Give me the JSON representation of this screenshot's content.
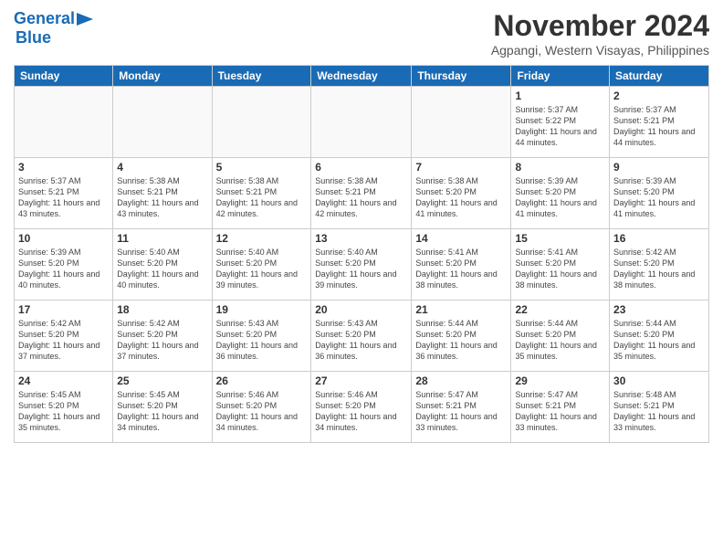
{
  "header": {
    "logo_general": "General",
    "logo_blue": "Blue",
    "month_year": "November 2024",
    "location": "Agpangi, Western Visayas, Philippines"
  },
  "days_of_week": [
    "Sunday",
    "Monday",
    "Tuesday",
    "Wednesday",
    "Thursday",
    "Friday",
    "Saturday"
  ],
  "weeks": [
    [
      {
        "day": "",
        "info": ""
      },
      {
        "day": "",
        "info": ""
      },
      {
        "day": "",
        "info": ""
      },
      {
        "day": "",
        "info": ""
      },
      {
        "day": "",
        "info": ""
      },
      {
        "day": "1",
        "info": "Sunrise: 5:37 AM\nSunset: 5:22 PM\nDaylight: 11 hours and 44 minutes."
      },
      {
        "day": "2",
        "info": "Sunrise: 5:37 AM\nSunset: 5:21 PM\nDaylight: 11 hours and 44 minutes."
      }
    ],
    [
      {
        "day": "3",
        "info": "Sunrise: 5:37 AM\nSunset: 5:21 PM\nDaylight: 11 hours and 43 minutes."
      },
      {
        "day": "4",
        "info": "Sunrise: 5:38 AM\nSunset: 5:21 PM\nDaylight: 11 hours and 43 minutes."
      },
      {
        "day": "5",
        "info": "Sunrise: 5:38 AM\nSunset: 5:21 PM\nDaylight: 11 hours and 42 minutes."
      },
      {
        "day": "6",
        "info": "Sunrise: 5:38 AM\nSunset: 5:21 PM\nDaylight: 11 hours and 42 minutes."
      },
      {
        "day": "7",
        "info": "Sunrise: 5:38 AM\nSunset: 5:20 PM\nDaylight: 11 hours and 41 minutes."
      },
      {
        "day": "8",
        "info": "Sunrise: 5:39 AM\nSunset: 5:20 PM\nDaylight: 11 hours and 41 minutes."
      },
      {
        "day": "9",
        "info": "Sunrise: 5:39 AM\nSunset: 5:20 PM\nDaylight: 11 hours and 41 minutes."
      }
    ],
    [
      {
        "day": "10",
        "info": "Sunrise: 5:39 AM\nSunset: 5:20 PM\nDaylight: 11 hours and 40 minutes."
      },
      {
        "day": "11",
        "info": "Sunrise: 5:40 AM\nSunset: 5:20 PM\nDaylight: 11 hours and 40 minutes."
      },
      {
        "day": "12",
        "info": "Sunrise: 5:40 AM\nSunset: 5:20 PM\nDaylight: 11 hours and 39 minutes."
      },
      {
        "day": "13",
        "info": "Sunrise: 5:40 AM\nSunset: 5:20 PM\nDaylight: 11 hours and 39 minutes."
      },
      {
        "day": "14",
        "info": "Sunrise: 5:41 AM\nSunset: 5:20 PM\nDaylight: 11 hours and 38 minutes."
      },
      {
        "day": "15",
        "info": "Sunrise: 5:41 AM\nSunset: 5:20 PM\nDaylight: 11 hours and 38 minutes."
      },
      {
        "day": "16",
        "info": "Sunrise: 5:42 AM\nSunset: 5:20 PM\nDaylight: 11 hours and 38 minutes."
      }
    ],
    [
      {
        "day": "17",
        "info": "Sunrise: 5:42 AM\nSunset: 5:20 PM\nDaylight: 11 hours and 37 minutes."
      },
      {
        "day": "18",
        "info": "Sunrise: 5:42 AM\nSunset: 5:20 PM\nDaylight: 11 hours and 37 minutes."
      },
      {
        "day": "19",
        "info": "Sunrise: 5:43 AM\nSunset: 5:20 PM\nDaylight: 11 hours and 36 minutes."
      },
      {
        "day": "20",
        "info": "Sunrise: 5:43 AM\nSunset: 5:20 PM\nDaylight: 11 hours and 36 minutes."
      },
      {
        "day": "21",
        "info": "Sunrise: 5:44 AM\nSunset: 5:20 PM\nDaylight: 11 hours and 36 minutes."
      },
      {
        "day": "22",
        "info": "Sunrise: 5:44 AM\nSunset: 5:20 PM\nDaylight: 11 hours and 35 minutes."
      },
      {
        "day": "23",
        "info": "Sunrise: 5:44 AM\nSunset: 5:20 PM\nDaylight: 11 hours and 35 minutes."
      }
    ],
    [
      {
        "day": "24",
        "info": "Sunrise: 5:45 AM\nSunset: 5:20 PM\nDaylight: 11 hours and 35 minutes."
      },
      {
        "day": "25",
        "info": "Sunrise: 5:45 AM\nSunset: 5:20 PM\nDaylight: 11 hours and 34 minutes."
      },
      {
        "day": "26",
        "info": "Sunrise: 5:46 AM\nSunset: 5:20 PM\nDaylight: 11 hours and 34 minutes."
      },
      {
        "day": "27",
        "info": "Sunrise: 5:46 AM\nSunset: 5:20 PM\nDaylight: 11 hours and 34 minutes."
      },
      {
        "day": "28",
        "info": "Sunrise: 5:47 AM\nSunset: 5:21 PM\nDaylight: 11 hours and 33 minutes."
      },
      {
        "day": "29",
        "info": "Sunrise: 5:47 AM\nSunset: 5:21 PM\nDaylight: 11 hours and 33 minutes."
      },
      {
        "day": "30",
        "info": "Sunrise: 5:48 AM\nSunset: 5:21 PM\nDaylight: 11 hours and 33 minutes."
      }
    ]
  ]
}
